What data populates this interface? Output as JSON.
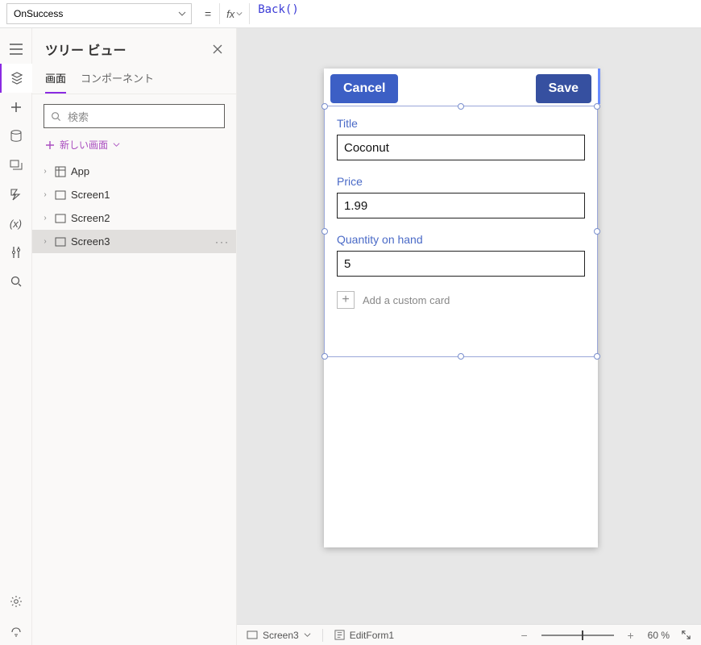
{
  "formula_bar": {
    "property": "OnSuccess",
    "fx_label": "fx",
    "formula_html": "<span class='fn'>Back</span><span class='paren'>()</span>"
  },
  "tree": {
    "title": "ツリー ビュー",
    "tabs": {
      "screens": "画面",
      "components": "コンポーネント"
    },
    "search_placeholder": "検索",
    "new_screen": "新しい画面",
    "items": [
      {
        "label": "App",
        "kind": "app"
      },
      {
        "label": "Screen1",
        "kind": "screen"
      },
      {
        "label": "Screen2",
        "kind": "screen"
      },
      {
        "label": "Screen3",
        "kind": "screen",
        "selected": true
      }
    ]
  },
  "phone": {
    "cancel": "Cancel",
    "save": "Save",
    "fields": {
      "title": {
        "label": "Title",
        "value": "Coconut"
      },
      "price": {
        "label": "Price",
        "value": "1.99"
      },
      "qty": {
        "label": "Quantity on hand",
        "value": "5"
      }
    },
    "add_card": "Add a custom card"
  },
  "status": {
    "screen": "Screen3",
    "control": "EditForm1",
    "zoom": "60 %"
  }
}
